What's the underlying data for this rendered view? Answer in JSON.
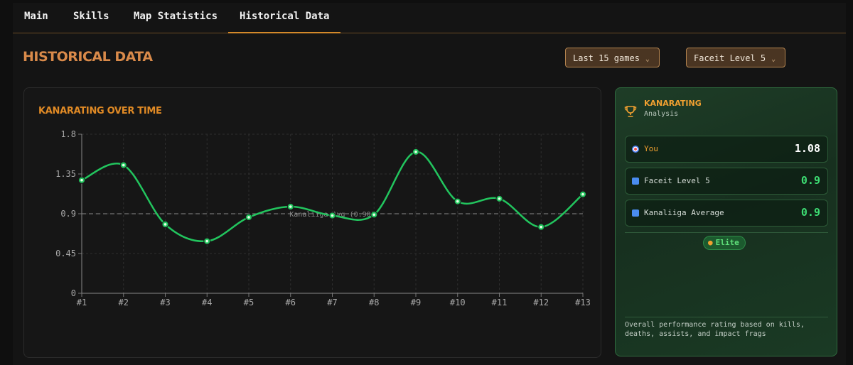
{
  "tabs": [
    {
      "label": "Main",
      "active": false
    },
    {
      "label": "Skills",
      "active": false
    },
    {
      "label": "Map Statistics",
      "active": false
    },
    {
      "label": "Historical Data",
      "active": true
    }
  ],
  "header": {
    "title": "HISTORICAL DATA",
    "range_select": "Last 15 games",
    "level_select": "Faceit Level 5"
  },
  "chart_card": {
    "title": "KANARATING OVER TIME"
  },
  "chart_data": {
    "type": "line",
    "title": "KANARATING OVER TIME",
    "categories": [
      "#1",
      "#2",
      "#3",
      "#4",
      "#5",
      "#6",
      "#7",
      "#8",
      "#9",
      "#10",
      "#11",
      "#12",
      "#13"
    ],
    "series": [
      {
        "values": [
          1.28,
          1.45,
          0.78,
          0.59,
          0.86,
          0.98,
          0.88,
          0.89,
          1.6,
          1.04,
          1.07,
          0.75,
          1.12
        ],
        "color": "#22c55e"
      }
    ],
    "reference_line": {
      "label": "Kanaliiga Avg (0.90)",
      "value": 0.9
    },
    "yticks": [
      "1.8",
      "1.35",
      "0.9",
      "0.45",
      "0"
    ],
    "ylim": [
      0,
      1.8
    ],
    "grid": true
  },
  "side": {
    "title": "KANARATING",
    "subtitle": "Analysis",
    "stats": [
      {
        "label": "You",
        "value": "1.08",
        "label_color": "#f0a030",
        "value_color": "#ffffff",
        "icon": "target-icon"
      },
      {
        "label": "Faceit Level 5",
        "value": "0.9",
        "label_color": "#d6ddd8",
        "value_color": "#3ddc73",
        "icon": "chart-icon"
      },
      {
        "label": "Kanaliiga Average",
        "value": "0.9",
        "label_color": "#d6ddd8",
        "value_color": "#3ddc73",
        "icon": "chart-icon"
      }
    ],
    "badge": "Elite",
    "description": "Overall performance rating based on kills, deaths, assists, and impact frags"
  },
  "colors": {
    "accent": "#e08a25",
    "line": "#22c55e",
    "panel_border": "#2f6a3e"
  }
}
